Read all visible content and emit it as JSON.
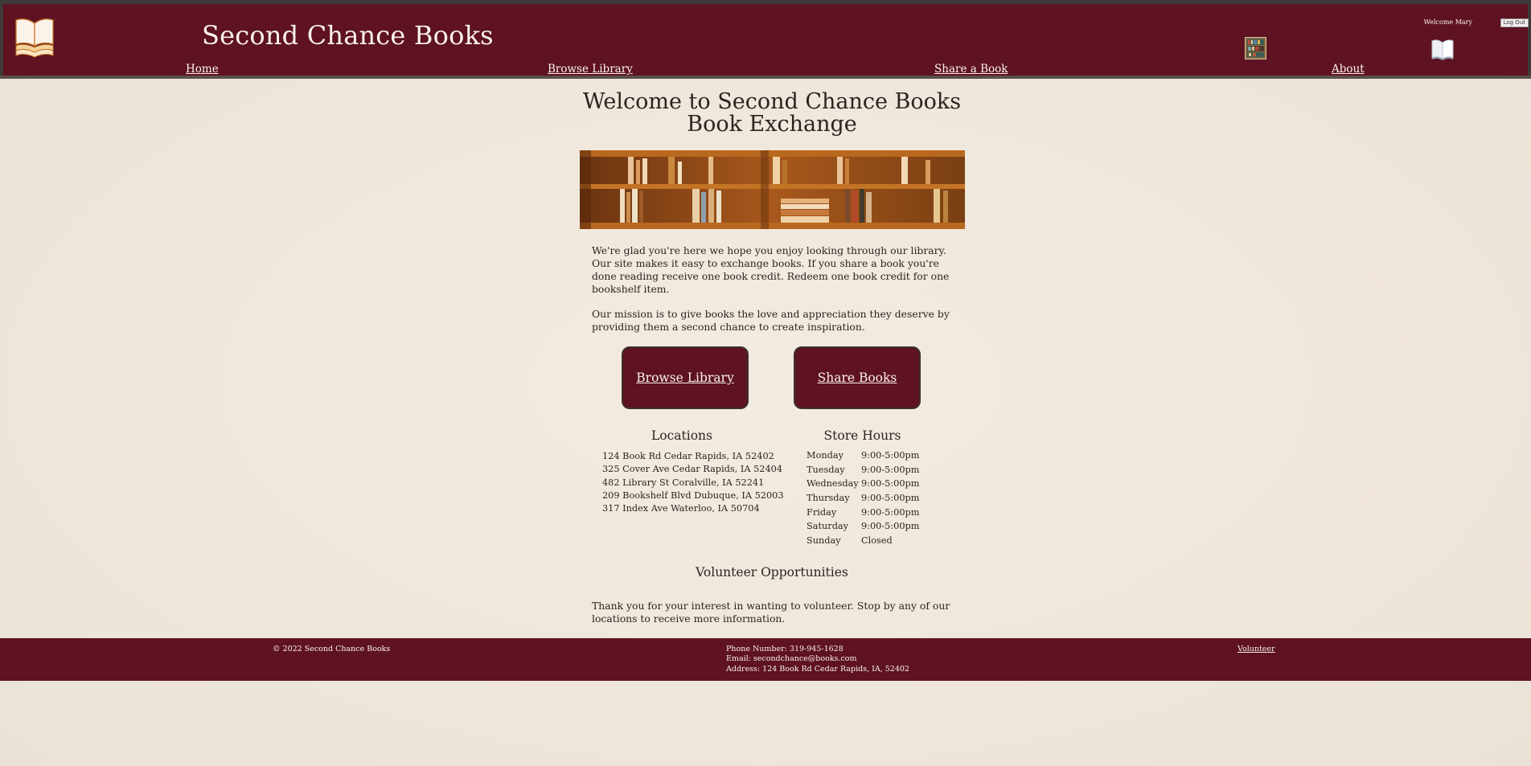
{
  "header": {
    "title": "Second Chance Books",
    "nav": {
      "home": "Home",
      "browse": "Browse Library",
      "share": "Share a Book",
      "about": "About"
    },
    "welcome": "Welcome Mary",
    "logout_label": "Log Out",
    "icons": [
      "open-book-logo-icon",
      "bookshelf-icon",
      "open-book-icon"
    ]
  },
  "main": {
    "heading_line1": "Welcome to Second Chance Books",
    "heading_line2": "Book Exchange",
    "intro": "We're glad you're here we hope you enjoy looking through our library. Our site makes it easy to exchange books. If you share a book you're done reading receive one book credit. Redeem one book credit for one bookshelf item.",
    "mission": "Our mission is to give books the love and appreciation they deserve by providing them a second chance to create inspiration.",
    "buttons": {
      "browse": "Browse Library",
      "share": "Share Books"
    }
  },
  "locations": {
    "title": "Locations",
    "items": [
      "124 Book Rd Cedar Rapids, IA 52402",
      "325 Cover Ave Cedar Rapids, IA 52404",
      "482 Library St Coralville, IA 52241",
      "209 Bookshelf Blvd Dubuque, IA 52003",
      "317 Index Ave Waterloo, IA 50704"
    ]
  },
  "hours": {
    "title": "Store Hours",
    "rows": [
      {
        "day": "Monday",
        "time": "9:00-5:00pm"
      },
      {
        "day": "Tuesday",
        "time": "9:00-5:00pm"
      },
      {
        "day": "Wednesday",
        "time": "9:00-5:00pm"
      },
      {
        "day": "Thursday",
        "time": "9:00-5:00pm"
      },
      {
        "day": "Friday",
        "time": "9:00-5:00pm"
      },
      {
        "day": "Saturday",
        "time": "9:00-5:00pm"
      },
      {
        "day": "Sunday",
        "time": "Closed"
      }
    ]
  },
  "volunteer": {
    "title": "Volunteer Opportunities",
    "text": "Thank you for your interest in wanting to volunteer. Stop by any of our locations to receive more information."
  },
  "footer": {
    "copyright": "© 2022 Second Chance Books",
    "phone": "Phone Number: 319-945-1628",
    "email": "Email: secondchance@books.com",
    "address": "Address: 124 Book Rd Cedar Rapids, IA, 52402",
    "volunteer_link": "Volunteer"
  },
  "colors": {
    "brand": "#5e1222",
    "background": "#f0e7dc",
    "header_text": "#fbf3ea"
  }
}
